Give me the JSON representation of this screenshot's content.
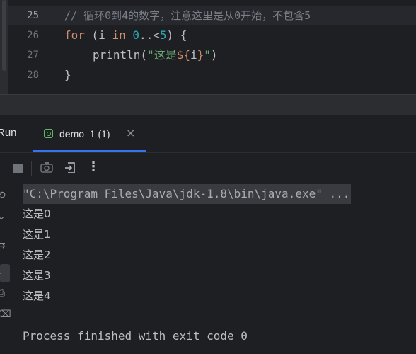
{
  "editor": {
    "lines": [
      {
        "no": "25",
        "comment": "// 循环0到4的数字，注意这里是从0开始，不包含5"
      },
      {
        "no": "26",
        "kw_for": "for",
        "paren_open": " (i ",
        "kw_in": "in",
        "space": " ",
        "range_start": "0",
        "range_op": "..<",
        "range_end": "5",
        "paren_close": ") {"
      },
      {
        "no": "27",
        "fn": "println(",
        "str_open": "\"这是",
        "tpl_open": "${",
        "tpl_var": "i",
        "tpl_close": "}",
        "str_close": "\"",
        "fn_close": ")"
      },
      {
        "no": "28",
        "brace": "}"
      }
    ]
  },
  "toolwindow": {
    "title": "Run",
    "tab": {
      "label": "demo_1 (1)",
      "close": "×"
    }
  },
  "toolbar": {
    "more_icon": "⋮",
    "icons": [
      "stop-icon",
      "camera-icon",
      "exit-icon",
      "more-icon"
    ]
  },
  "console": {
    "command": "\"C:\\Program Files\\Java\\jdk-1.8\\bin\\java.exe\" ...",
    "output": [
      "这是0",
      "这是1",
      "这是2",
      "这是3",
      "这是4"
    ],
    "finish": "Process finished with exit code 0"
  },
  "colors": {
    "background": "#1e1f22",
    "keyword": "#cf8e6d",
    "number": "#2aacb8",
    "string": "#6aab73",
    "comment": "#7a7e85",
    "tab_underline": "#3574f0"
  }
}
